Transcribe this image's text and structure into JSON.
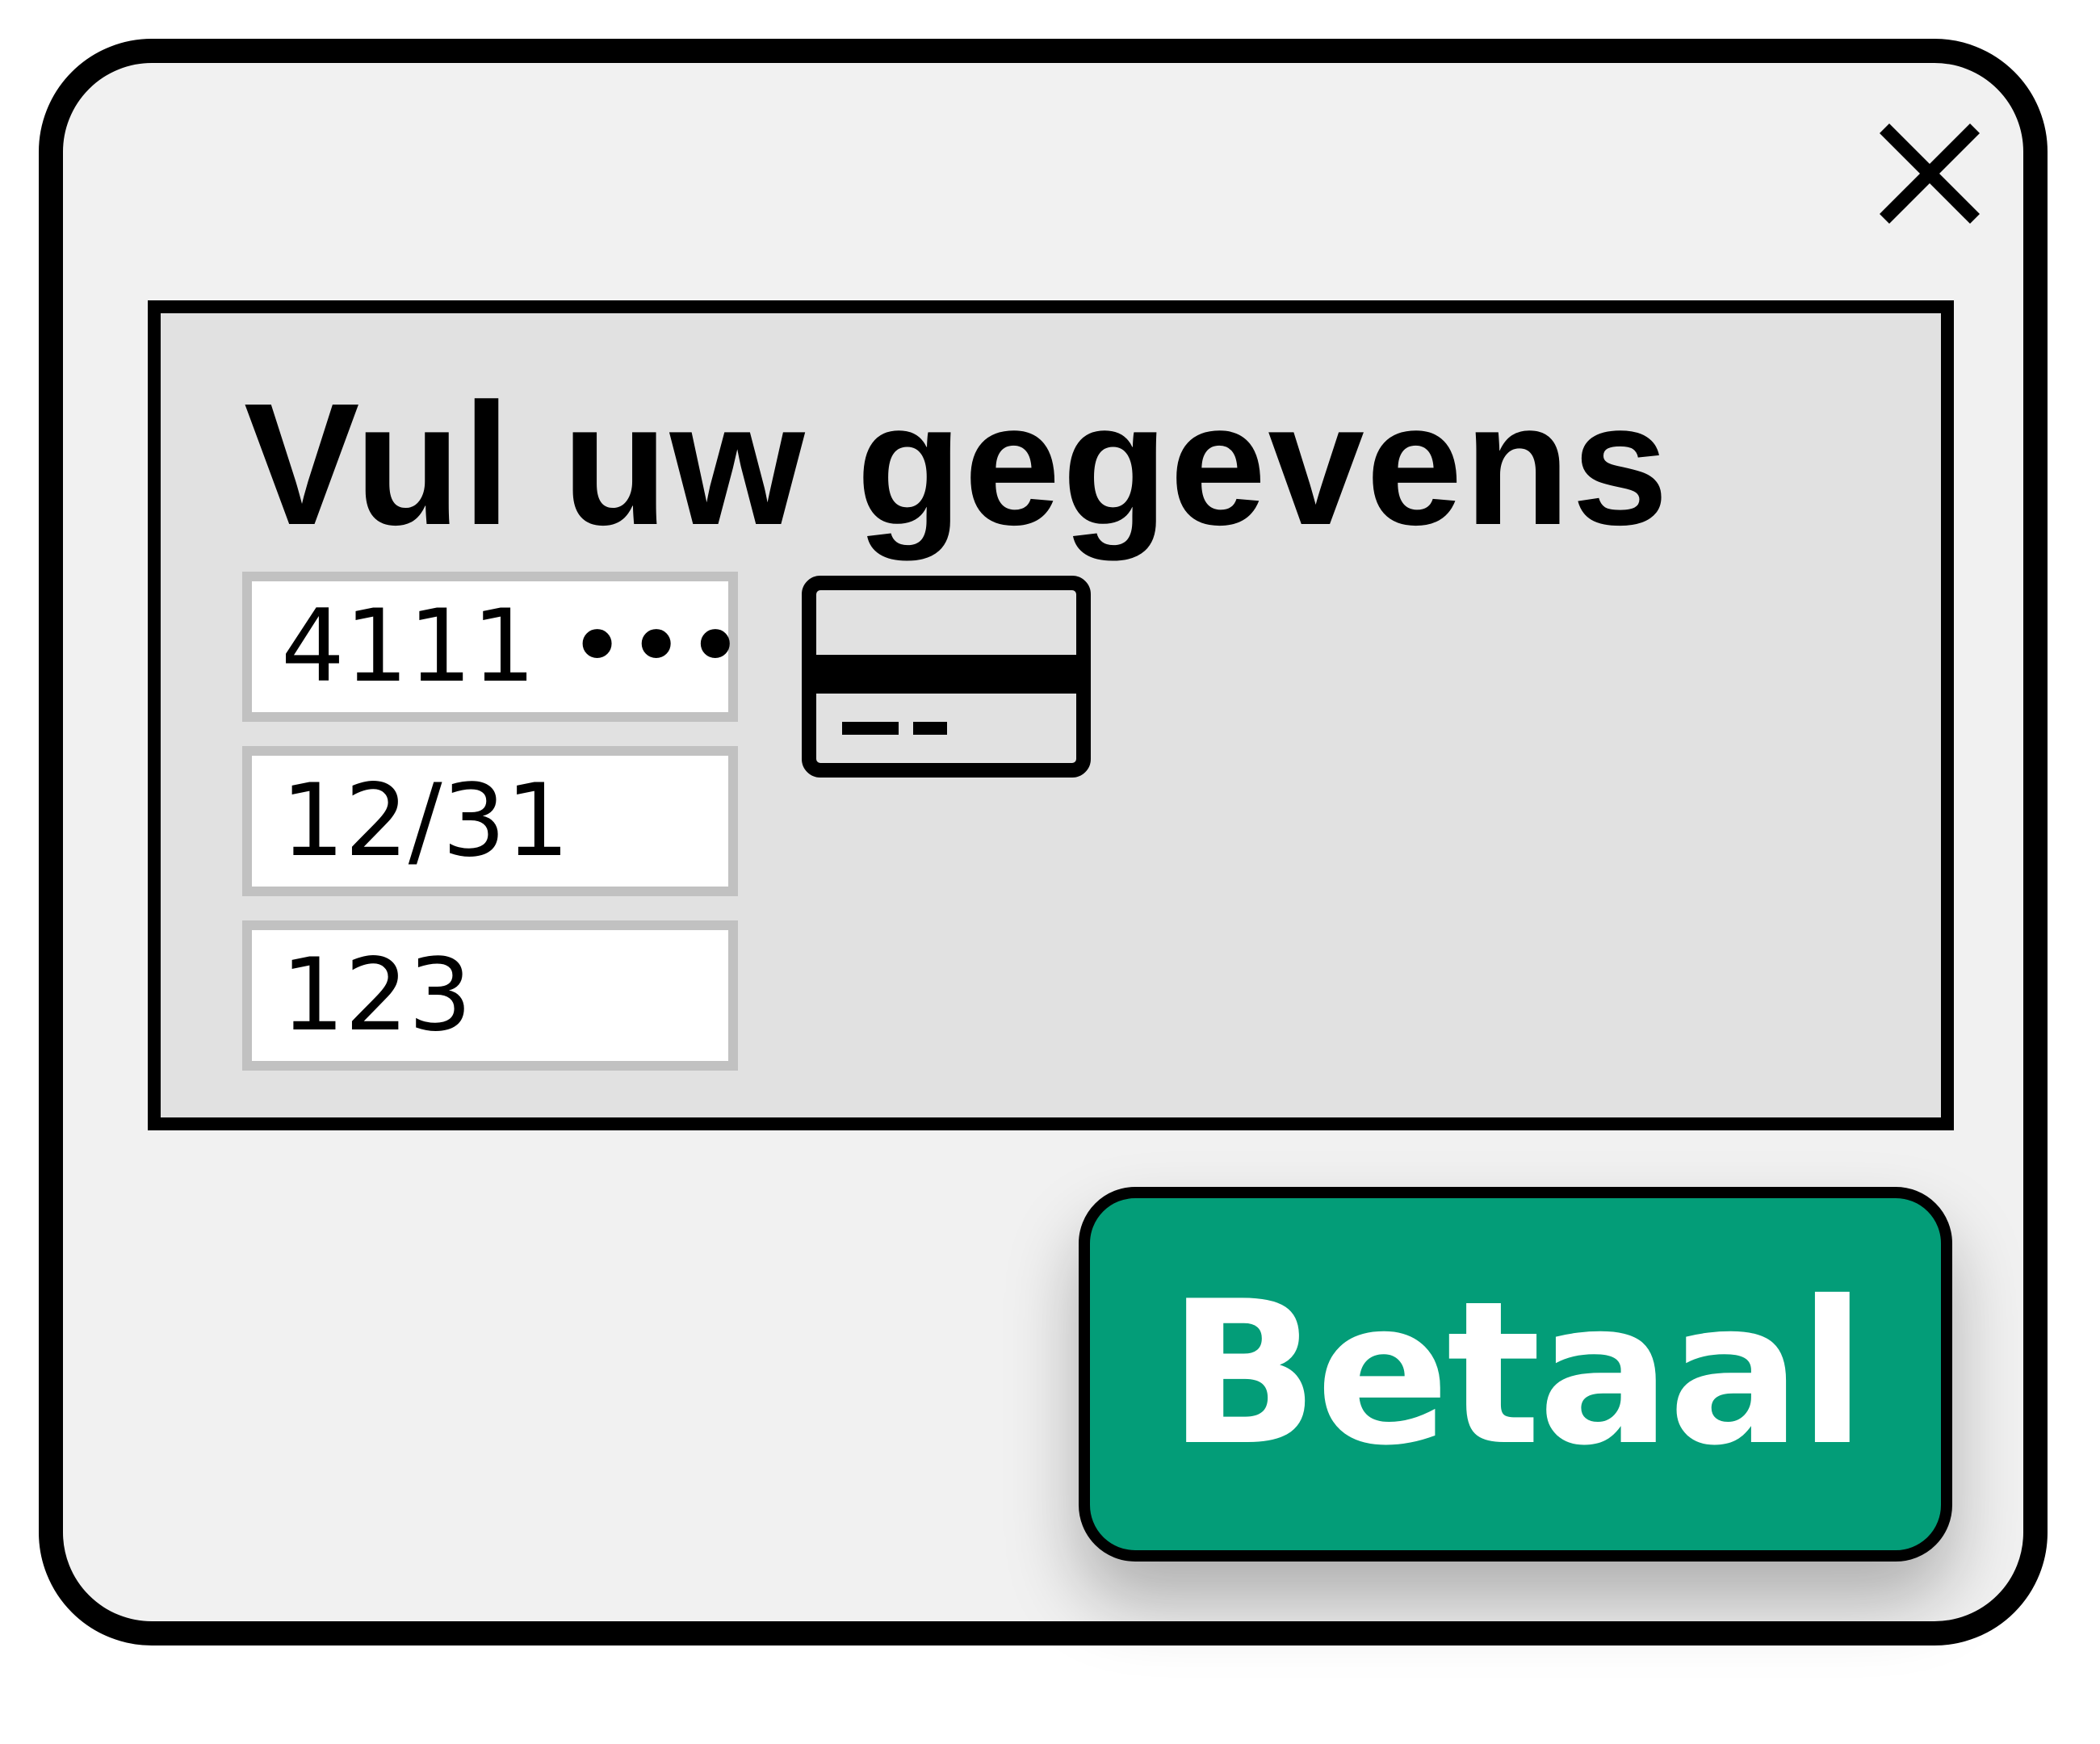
{
  "dialog": {
    "close_icon": "close-icon",
    "title": "Vul uw gegevens"
  },
  "form": {
    "card_number": "4111 •••",
    "expiry": "12/31",
    "cvc": "123",
    "card_icon": "credit-card-icon"
  },
  "actions": {
    "pay_label": "Betaal"
  },
  "colors": {
    "dialog_background": "#f1f1f1",
    "panel_background": "#e1e1e1",
    "field_border": "#c1c1c1",
    "pay_button": "#039d78",
    "pay_text": "#ffffff",
    "outline": "#000000"
  }
}
